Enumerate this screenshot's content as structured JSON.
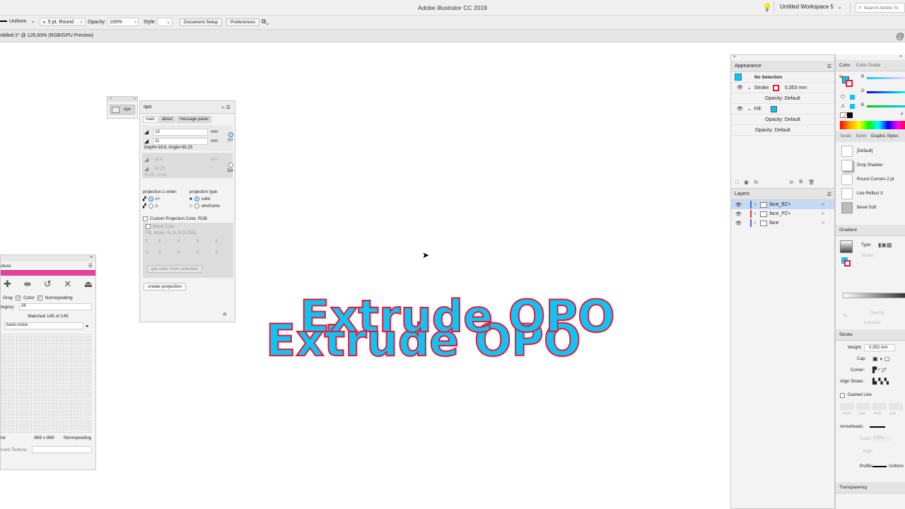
{
  "app": {
    "title": "Adobe Illustrator CC 2019",
    "workspace": "Untitled Workspace 5",
    "search_placeholder": "Search Adobe St"
  },
  "control_bar": {
    "stroke_profile": "Uniform",
    "brush": "5 pt. Round",
    "opacity_label": "Opacity:",
    "opacity_value": "100%",
    "style_label": "Style:",
    "doc_setup": "Document Setup",
    "preferences": "Preferences"
  },
  "document": {
    "tab_title": "ntitled-1* @ 126,83% (RGB/GPU Preview)"
  },
  "canvas": {
    "artwork_text": "Extrude OPO",
    "fill_color": "#12c2f0",
    "stroke_color": "#e8173a"
  },
  "mini_panel": {
    "label": "opo"
  },
  "opo_panel": {
    "title": "opo",
    "tabs": [
      "main",
      "about",
      "message panel"
    ],
    "field1": "15",
    "field2": "11",
    "unit": "mm",
    "xy_label": "XY",
    "depth_text": "Depth=18.6, Angle=36.25",
    "field3": "18.6",
    "field4": "36.25",
    "deg": "°",
    "hv_text": "H=15, V=11",
    "da_label": "DA",
    "zorder_label": "projection z-order:",
    "zplus": "z+",
    "zminus": "z-",
    "type_label": "projection type:",
    "solid": "solid",
    "wireframe": "wireframe",
    "custom_color": "Custom Projection Color, RGB",
    "blend_color": "Blend Color",
    "fill_stroke": "Fill, stroke, R, G, B [0-255]:",
    "f_label": "f:",
    "s_label": "s:",
    "f_vals": [
      "0",
      "0",
      "0",
      "0"
    ],
    "s_vals": [
      "0",
      "0",
      "0",
      "0"
    ],
    "get_color": "get color from selected",
    "create": "create projection",
    "r_label": "R"
  },
  "texture_panel": {
    "title": "xture",
    "gray": "Gray",
    "color": "Color",
    "nonrepeating": "Nonrepeating",
    "category_label": "tegory:",
    "category_value": "All",
    "matched": "Matched 145 of 145",
    "preset": "basic-noise",
    "size_left": "lor",
    "size": "869 x 869",
    "size_right": "Nonrepeating",
    "current_label": "rrent Texture:"
  },
  "appearance": {
    "title": "Appearance",
    "no_selection": "No Selection",
    "stroke_label": "Stroke:",
    "stroke_value": "0,353 mm",
    "opacity1": "Opacity: Default",
    "fill_label": "Fill:",
    "opacity2": "Opacity: Default",
    "opacity3": "Opacity: Default"
  },
  "layers": {
    "title": "Layers",
    "items": [
      {
        "name": "face_BZ+",
        "color": "#3a6ee8"
      },
      {
        "name": "face_PZ+",
        "color": "#e03a3a"
      },
      {
        "name": "face",
        "color": "#3a6ee8"
      }
    ]
  },
  "color_panel": {
    "tab1": "Color",
    "tab2": "Color Guide",
    "r": "R",
    "g": "G",
    "b": "B",
    "hash": "#"
  },
  "graphic_styles": {
    "tabs": [
      "Swatc",
      "Symb",
      "Graphic Styles"
    ],
    "items": [
      "[Default]",
      "Drop Shadow",
      "Round Corners 2 pt",
      "Live Reflect X",
      "Bevel Soft"
    ]
  },
  "gradient": {
    "title": "Gradient",
    "type_label": "Type:",
    "stroke_label": "Stroke:",
    "opacity_label": "Opacity:",
    "location_label": "Location:"
  },
  "stroke_panel": {
    "title": "Stroke",
    "weight_label": "Weight:",
    "weight_value": "0,353 mm",
    "cap_label": "Cap:",
    "corner_label": "Corner:",
    "align_label": "Align Stroke:",
    "dashed": "Dashed Line",
    "dash_labels": [
      "dash",
      "gap",
      "dash",
      "gap"
    ],
    "arrowheads_label": "Arrowheads:",
    "scale_label": "Scale:",
    "scale_value": "100%",
    "align2_label": "Align:",
    "profile_label": "Profile:",
    "profile_value": "Uniform"
  },
  "transparency": {
    "title": "Transparency"
  }
}
